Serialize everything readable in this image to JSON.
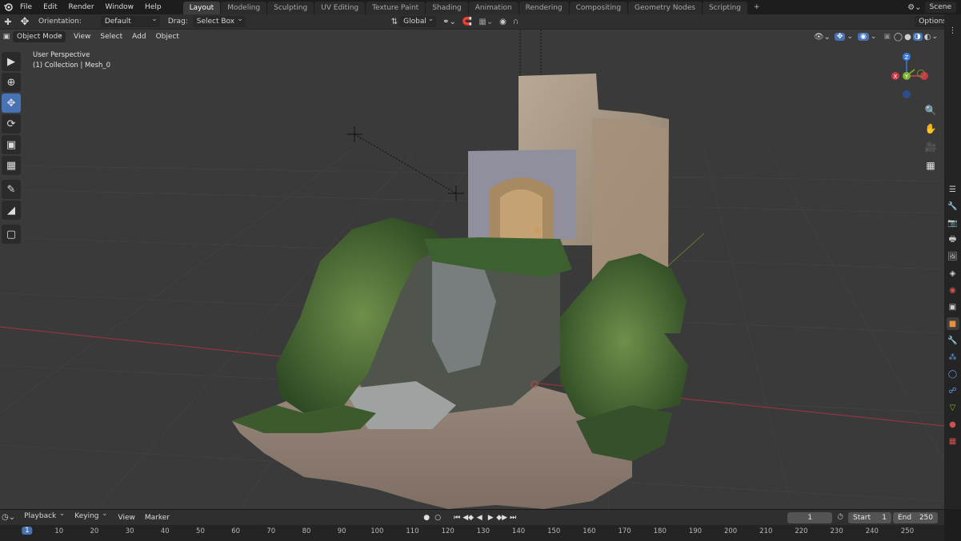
{
  "topbar": {
    "menus": [
      "File",
      "Edit",
      "Render",
      "Window",
      "Help"
    ],
    "workspace_tabs": [
      "Layout",
      "Modeling",
      "Sculpting",
      "UV Editing",
      "Texture Paint",
      "Shading",
      "Animation",
      "Rendering",
      "Compositing",
      "Geometry Nodes",
      "Scripting"
    ],
    "active_tab": "Layout",
    "add_tab": "+",
    "scene_label": "Scene"
  },
  "tool_header": {
    "orientation_label": "Orientation:",
    "orientation_value": "Default",
    "drag_label": "Drag:",
    "drag_value": "Select Box",
    "transform_orientation": "Global",
    "options_label": "Options"
  },
  "viewport_header": {
    "mode": "Object Mode",
    "menus": [
      "View",
      "Select",
      "Add",
      "Object"
    ]
  },
  "viewport": {
    "perspective": "User Perspective",
    "collection_info": "(1) Collection | Mesh_0",
    "gizmo": {
      "x": "X",
      "y": "Y",
      "z": "Z"
    }
  },
  "timeline_header": {
    "menus": [
      "Playback",
      "Keying",
      "View",
      "Marker"
    ],
    "current_frame": "1",
    "start_label": "Start",
    "start_value": "1",
    "end_label": "End",
    "end_value": "250"
  },
  "timeline": {
    "ticks": [
      "1",
      "10",
      "20",
      "30",
      "40",
      "50",
      "60",
      "70",
      "80",
      "90",
      "100",
      "110",
      "120",
      "130",
      "140",
      "150",
      "160",
      "170",
      "180",
      "190",
      "200",
      "210",
      "220",
      "230",
      "240",
      "250"
    ]
  },
  "colors": {
    "accent": "#4772b3",
    "x_axis": "#e23c4c",
    "y_axis": "#7cb52d",
    "z_axis": "#3a7be0"
  }
}
